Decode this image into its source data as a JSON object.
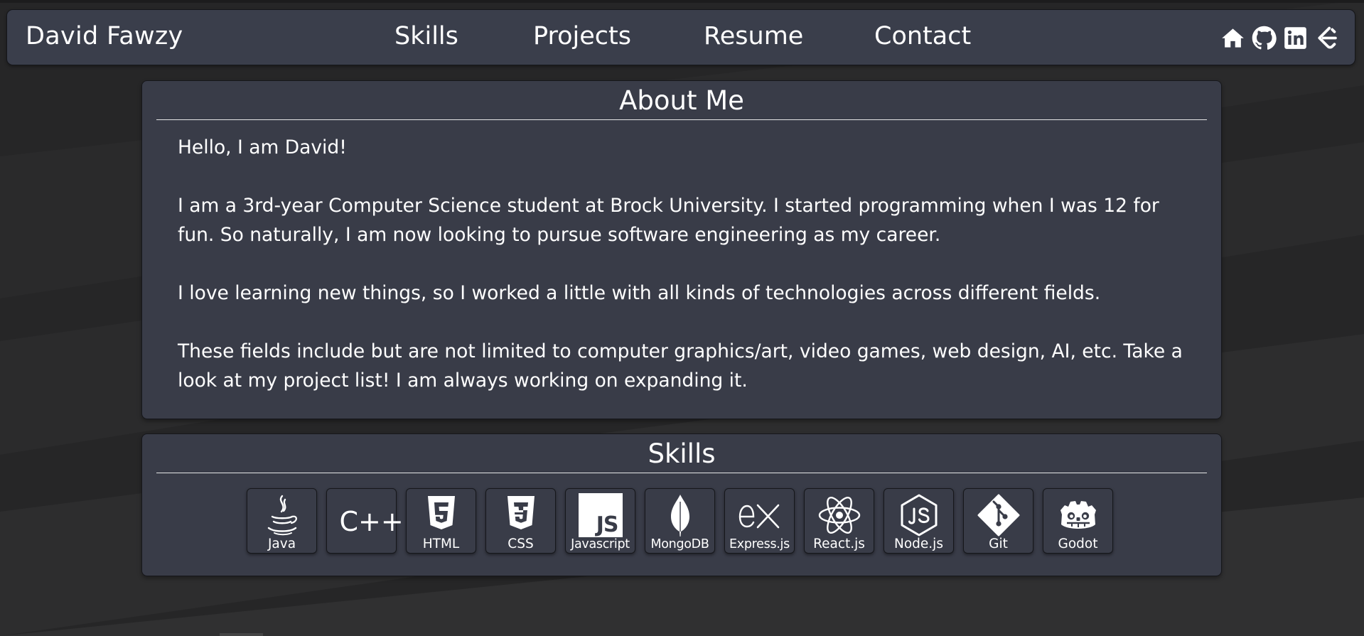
{
  "colors": {
    "page_bg": "#262627",
    "panel_bg": "#393c48",
    "navbar_bg": "#3a3e4b",
    "text": "#ffffff",
    "rule": "#e6e6e6"
  },
  "navbar": {
    "brand": "David Fawzy",
    "links": [
      "Skills",
      "Projects",
      "Resume",
      "Contact"
    ],
    "icons": [
      "home-icon",
      "github-icon",
      "linkedin-icon",
      "leetcode-icon"
    ]
  },
  "about": {
    "title": "About Me",
    "paragraphs": [
      "Hello, I am David!",
      "I am a 3rd-year Computer Science student at Brock University. I started programming when I was 12 for fun. So naturally, I am now looking to pursue software engineering as my career.",
      "I love learning new things, so I worked a little with all kinds of technologies across different fields.",
      "These fields include but are not limited to computer graphics/art, video games, web design, AI, etc. Take a look at my project list! I am always working on expanding it."
    ]
  },
  "skills": {
    "title": "Skills",
    "items": [
      {
        "label": "Java",
        "icon": "java-icon"
      },
      {
        "label": "C++",
        "icon": "cplusplus-icon"
      },
      {
        "label": "HTML",
        "icon": "html5-icon"
      },
      {
        "label": "CSS",
        "icon": "css3-icon"
      },
      {
        "label": "Javascript",
        "icon": "javascript-icon"
      },
      {
        "label": "MongoDB",
        "icon": "mongodb-icon"
      },
      {
        "label": "Express.js",
        "icon": "express-icon"
      },
      {
        "label": "React.js",
        "icon": "react-icon"
      },
      {
        "label": "Node.js",
        "icon": "nodejs-icon"
      },
      {
        "label": "Git",
        "icon": "git-icon"
      },
      {
        "label": "Godot",
        "icon": "godot-icon"
      }
    ],
    "cplusplus_logo_text": "C++",
    "javascript_logo_text": "JS"
  }
}
